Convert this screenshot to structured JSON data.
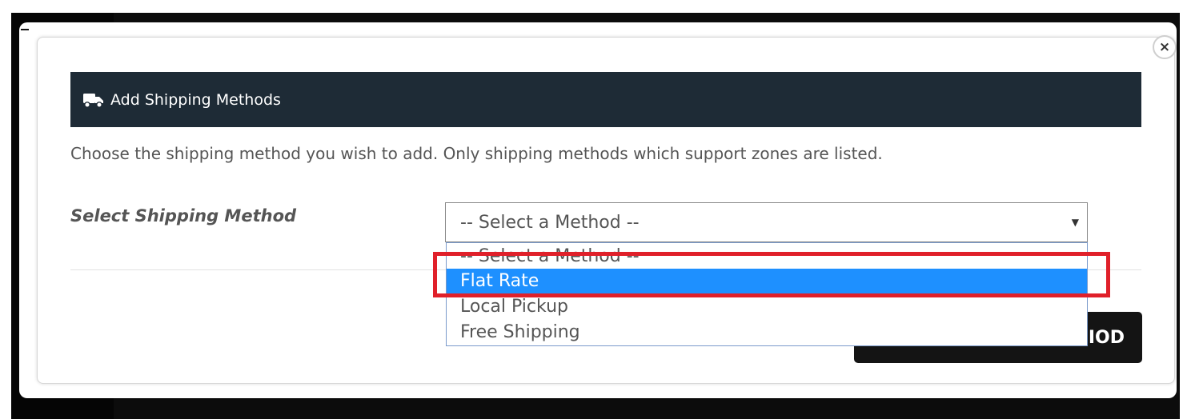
{
  "modal": {
    "close_label": "×",
    "header_icon": "truck-icon",
    "title": "Add Shipping Methods",
    "description": "Choose the shipping method you wish to add. Only shipping methods which support zones are listed.",
    "field_label": "Select Shipping Method",
    "select": {
      "current_value": "-- Select a Method --",
      "arrow": "▼",
      "options": [
        "-- Select a Method --",
        "Flat Rate",
        "Local Pickup",
        "Free Shipping"
      ],
      "highlighted_option": "Flat Rate"
    },
    "add_button_visible_text": "IOD"
  },
  "colors": {
    "header_bg": "#1e2b36",
    "option_highlight": "#1e90ff",
    "annotation_box": "#e0202a",
    "button_bg": "#141414"
  }
}
